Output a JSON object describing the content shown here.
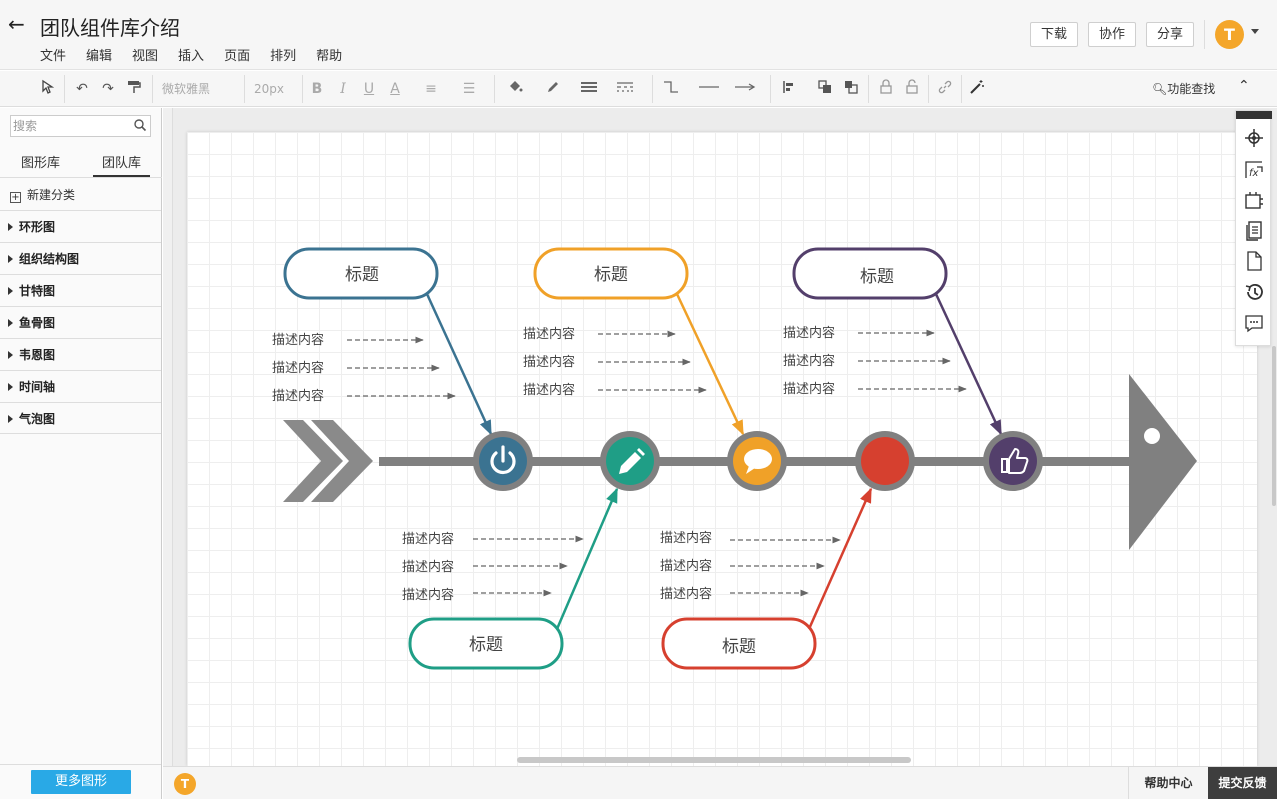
{
  "header": {
    "title": "团队组件库介绍",
    "menu": [
      "文件",
      "编辑",
      "视图",
      "插入",
      "页面",
      "排列",
      "帮助"
    ],
    "buttons": {
      "download": "下载",
      "collab": "协作",
      "share": "分享"
    },
    "avatar_letter": "T"
  },
  "toolbar": {
    "font_family": "微软雅黑",
    "font_size": "20px",
    "bold": "B",
    "italic": "I",
    "underline": "U",
    "font_color": "A",
    "function_search": "功能查找"
  },
  "sidebar": {
    "search_placeholder": "搜索",
    "tabs": [
      "图形库",
      "团队库"
    ],
    "new_category": "新建分类",
    "categories": [
      "环形图",
      "组织结构图",
      "甘特图",
      "鱼骨图",
      "韦恩图",
      "时间轴",
      "气泡图"
    ],
    "more_shapes": "更多图形"
  },
  "diagram": {
    "title_label": "标题",
    "desc_label": "描述内容",
    "colors": {
      "blue": "#3b7391",
      "teal": "#1f9e86",
      "orange": "#f0a128",
      "red": "#d6402f",
      "purple": "#533f6b",
      "spine": "#808080"
    },
    "nodes": [
      {
        "icon": "power-icon",
        "color": "#3b7391"
      },
      {
        "icon": "pencil-icon",
        "color": "#1f9e86"
      },
      {
        "icon": "chat-bubble-icon",
        "color": "#f0a128"
      },
      {
        "icon": "",
        "color": "#d6402f"
      },
      {
        "icon": "thumbs-up-icon",
        "color": "#533f6b"
      }
    ]
  },
  "bottombar": {
    "avatar_letter": "T",
    "help_center": "帮助中心",
    "feedback": "提交反馈"
  }
}
